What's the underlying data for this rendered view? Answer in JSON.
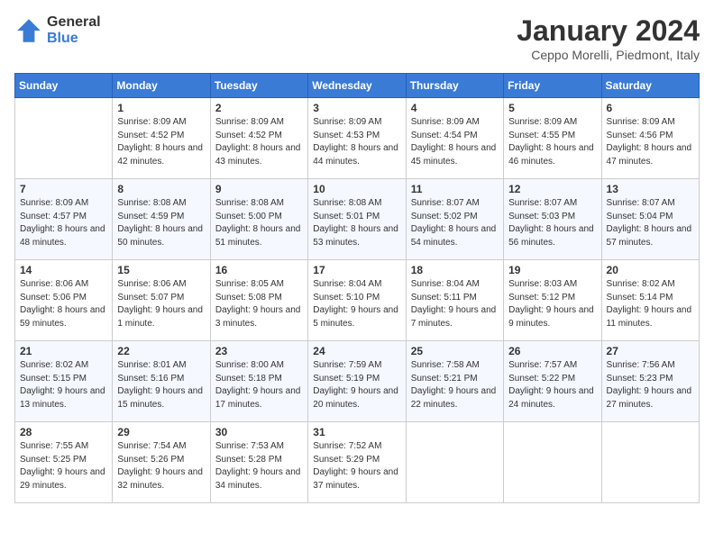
{
  "logo": {
    "general": "General",
    "blue": "Blue"
  },
  "title": "January 2024",
  "subtitle": "Ceppo Morelli, Piedmont, Italy",
  "days_of_week": [
    "Sunday",
    "Monday",
    "Tuesday",
    "Wednesday",
    "Thursday",
    "Friday",
    "Saturday"
  ],
  "weeks": [
    [
      {
        "num": "",
        "sunrise": "",
        "sunset": "",
        "daylight": ""
      },
      {
        "num": "1",
        "sunrise": "Sunrise: 8:09 AM",
        "sunset": "Sunset: 4:52 PM",
        "daylight": "Daylight: 8 hours and 42 minutes."
      },
      {
        "num": "2",
        "sunrise": "Sunrise: 8:09 AM",
        "sunset": "Sunset: 4:52 PM",
        "daylight": "Daylight: 8 hours and 43 minutes."
      },
      {
        "num": "3",
        "sunrise": "Sunrise: 8:09 AM",
        "sunset": "Sunset: 4:53 PM",
        "daylight": "Daylight: 8 hours and 44 minutes."
      },
      {
        "num": "4",
        "sunrise": "Sunrise: 8:09 AM",
        "sunset": "Sunset: 4:54 PM",
        "daylight": "Daylight: 8 hours and 45 minutes."
      },
      {
        "num": "5",
        "sunrise": "Sunrise: 8:09 AM",
        "sunset": "Sunset: 4:55 PM",
        "daylight": "Daylight: 8 hours and 46 minutes."
      },
      {
        "num": "6",
        "sunrise": "Sunrise: 8:09 AM",
        "sunset": "Sunset: 4:56 PM",
        "daylight": "Daylight: 8 hours and 47 minutes."
      }
    ],
    [
      {
        "num": "7",
        "sunrise": "Sunrise: 8:09 AM",
        "sunset": "Sunset: 4:57 PM",
        "daylight": "Daylight: 8 hours and 48 minutes."
      },
      {
        "num": "8",
        "sunrise": "Sunrise: 8:08 AM",
        "sunset": "Sunset: 4:59 PM",
        "daylight": "Daylight: 8 hours and 50 minutes."
      },
      {
        "num": "9",
        "sunrise": "Sunrise: 8:08 AM",
        "sunset": "Sunset: 5:00 PM",
        "daylight": "Daylight: 8 hours and 51 minutes."
      },
      {
        "num": "10",
        "sunrise": "Sunrise: 8:08 AM",
        "sunset": "Sunset: 5:01 PM",
        "daylight": "Daylight: 8 hours and 53 minutes."
      },
      {
        "num": "11",
        "sunrise": "Sunrise: 8:07 AM",
        "sunset": "Sunset: 5:02 PM",
        "daylight": "Daylight: 8 hours and 54 minutes."
      },
      {
        "num": "12",
        "sunrise": "Sunrise: 8:07 AM",
        "sunset": "Sunset: 5:03 PM",
        "daylight": "Daylight: 8 hours and 56 minutes."
      },
      {
        "num": "13",
        "sunrise": "Sunrise: 8:07 AM",
        "sunset": "Sunset: 5:04 PM",
        "daylight": "Daylight: 8 hours and 57 minutes."
      }
    ],
    [
      {
        "num": "14",
        "sunrise": "Sunrise: 8:06 AM",
        "sunset": "Sunset: 5:06 PM",
        "daylight": "Daylight: 8 hours and 59 minutes."
      },
      {
        "num": "15",
        "sunrise": "Sunrise: 8:06 AM",
        "sunset": "Sunset: 5:07 PM",
        "daylight": "Daylight: 9 hours and 1 minute."
      },
      {
        "num": "16",
        "sunrise": "Sunrise: 8:05 AM",
        "sunset": "Sunset: 5:08 PM",
        "daylight": "Daylight: 9 hours and 3 minutes."
      },
      {
        "num": "17",
        "sunrise": "Sunrise: 8:04 AM",
        "sunset": "Sunset: 5:10 PM",
        "daylight": "Daylight: 9 hours and 5 minutes."
      },
      {
        "num": "18",
        "sunrise": "Sunrise: 8:04 AM",
        "sunset": "Sunset: 5:11 PM",
        "daylight": "Daylight: 9 hours and 7 minutes."
      },
      {
        "num": "19",
        "sunrise": "Sunrise: 8:03 AM",
        "sunset": "Sunset: 5:12 PM",
        "daylight": "Daylight: 9 hours and 9 minutes."
      },
      {
        "num": "20",
        "sunrise": "Sunrise: 8:02 AM",
        "sunset": "Sunset: 5:14 PM",
        "daylight": "Daylight: 9 hours and 11 minutes."
      }
    ],
    [
      {
        "num": "21",
        "sunrise": "Sunrise: 8:02 AM",
        "sunset": "Sunset: 5:15 PM",
        "daylight": "Daylight: 9 hours and 13 minutes."
      },
      {
        "num": "22",
        "sunrise": "Sunrise: 8:01 AM",
        "sunset": "Sunset: 5:16 PM",
        "daylight": "Daylight: 9 hours and 15 minutes."
      },
      {
        "num": "23",
        "sunrise": "Sunrise: 8:00 AM",
        "sunset": "Sunset: 5:18 PM",
        "daylight": "Daylight: 9 hours and 17 minutes."
      },
      {
        "num": "24",
        "sunrise": "Sunrise: 7:59 AM",
        "sunset": "Sunset: 5:19 PM",
        "daylight": "Daylight: 9 hours and 20 minutes."
      },
      {
        "num": "25",
        "sunrise": "Sunrise: 7:58 AM",
        "sunset": "Sunset: 5:21 PM",
        "daylight": "Daylight: 9 hours and 22 minutes."
      },
      {
        "num": "26",
        "sunrise": "Sunrise: 7:57 AM",
        "sunset": "Sunset: 5:22 PM",
        "daylight": "Daylight: 9 hours and 24 minutes."
      },
      {
        "num": "27",
        "sunrise": "Sunrise: 7:56 AM",
        "sunset": "Sunset: 5:23 PM",
        "daylight": "Daylight: 9 hours and 27 minutes."
      }
    ],
    [
      {
        "num": "28",
        "sunrise": "Sunrise: 7:55 AM",
        "sunset": "Sunset: 5:25 PM",
        "daylight": "Daylight: 9 hours and 29 minutes."
      },
      {
        "num": "29",
        "sunrise": "Sunrise: 7:54 AM",
        "sunset": "Sunset: 5:26 PM",
        "daylight": "Daylight: 9 hours and 32 minutes."
      },
      {
        "num": "30",
        "sunrise": "Sunrise: 7:53 AM",
        "sunset": "Sunset: 5:28 PM",
        "daylight": "Daylight: 9 hours and 34 minutes."
      },
      {
        "num": "31",
        "sunrise": "Sunrise: 7:52 AM",
        "sunset": "Sunset: 5:29 PM",
        "daylight": "Daylight: 9 hours and 37 minutes."
      },
      {
        "num": "",
        "sunrise": "",
        "sunset": "",
        "daylight": ""
      },
      {
        "num": "",
        "sunrise": "",
        "sunset": "",
        "daylight": ""
      },
      {
        "num": "",
        "sunrise": "",
        "sunset": "",
        "daylight": ""
      }
    ]
  ]
}
